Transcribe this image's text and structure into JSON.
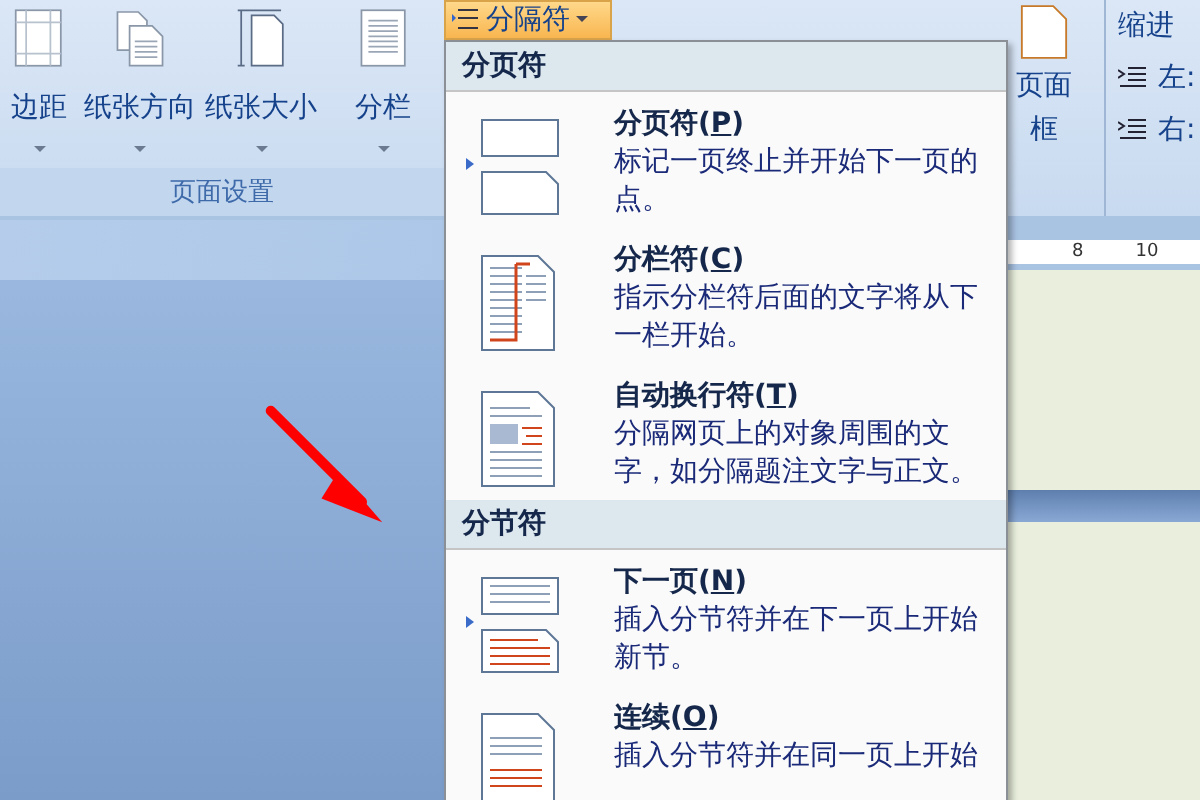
{
  "ribbon": {
    "page_setup": {
      "buttons": [
        {
          "label": "边距"
        },
        {
          "label": "纸张方向"
        },
        {
          "label": "纸张大小"
        },
        {
          "label": "分栏"
        }
      ],
      "group_label": "页面设置"
    },
    "page_border": {
      "lines": [
        "页面",
        "框"
      ]
    },
    "indent": {
      "title": "缩进",
      "rows": [
        "左:",
        "右:"
      ]
    }
  },
  "dropdown_button": {
    "label": "分隔符"
  },
  "menu": {
    "sections": [
      {
        "title": "分页符",
        "items": [
          {
            "title": "分页符(",
            "accel": "P",
            "title_end": ")",
            "description": "标记一页终止并开始下一页的点。"
          },
          {
            "title": "分栏符(",
            "accel": "C",
            "title_end": ")",
            "description": "指示分栏符后面的文字将从下一栏开始。"
          },
          {
            "title": "自动换行符(",
            "accel": "T",
            "title_end": ")",
            "description": "分隔网页上的对象周围的文字，如分隔题注文字与正文。"
          }
        ]
      },
      {
        "title": "分节符",
        "items": [
          {
            "title": "下一页(",
            "accel": "N",
            "title_end": ")",
            "description": "插入分节符并在下一页上开始新节。"
          },
          {
            "title": "连续(",
            "accel": "O",
            "title_end": ")",
            "description": "插入分节符并在同一页上开始"
          }
        ]
      }
    ]
  },
  "ruler": {
    "labels": [
      "8",
      "10"
    ]
  }
}
